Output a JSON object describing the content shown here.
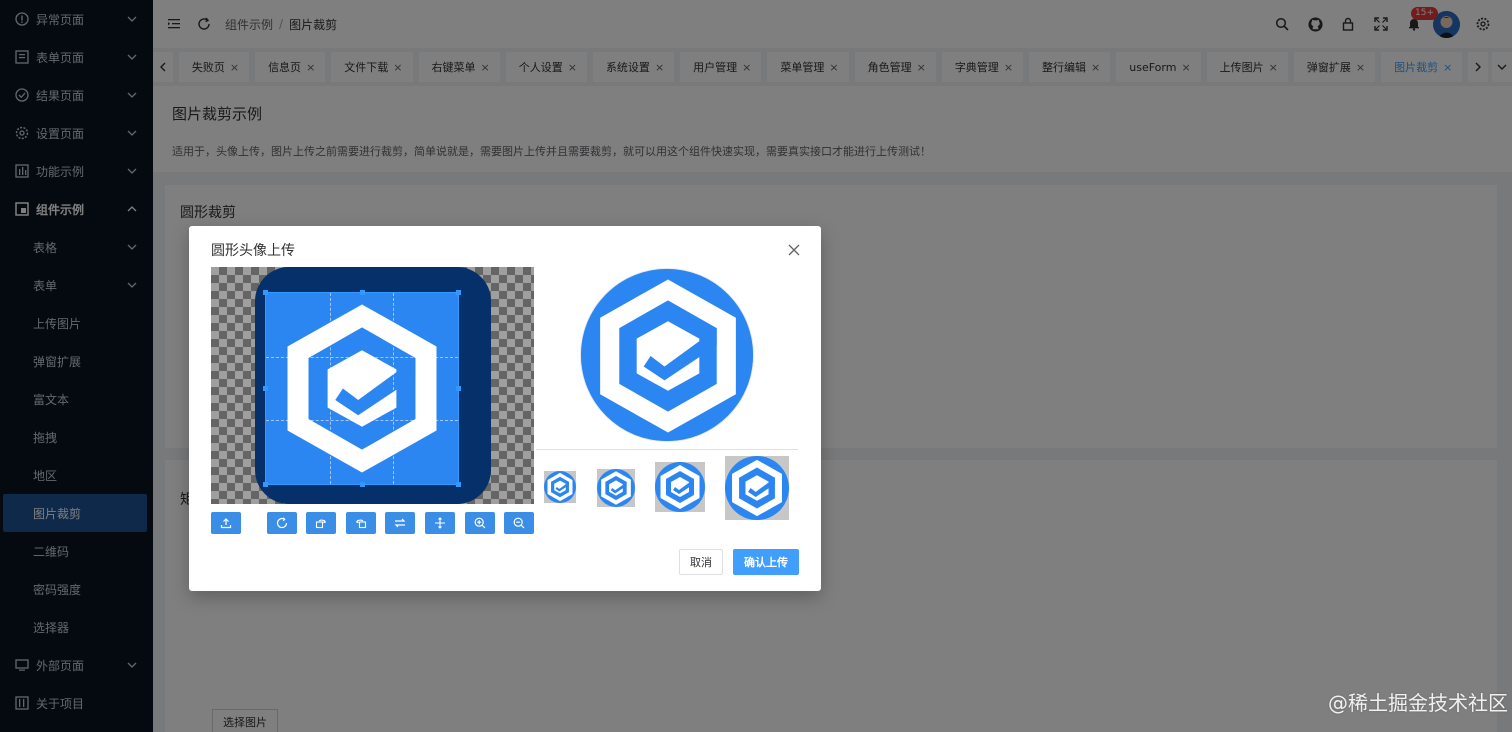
{
  "sidebar": {
    "items": [
      {
        "label": "异常页面",
        "icon": "info-circle-icon"
      },
      {
        "label": "表单页面",
        "icon": "form-icon"
      },
      {
        "label": "结果页面",
        "icon": "check-circle-icon"
      },
      {
        "label": "设置页面",
        "icon": "gear-icon"
      },
      {
        "label": "功能示例",
        "icon": "function-icon"
      },
      {
        "label": "组件示例",
        "icon": "component-icon"
      }
    ],
    "sub_items": [
      "表格",
      "表单",
      "上传图片",
      "弹窗扩展",
      "富文本",
      "拖拽",
      "地区",
      "图片裁剪",
      "二维码",
      "密码强度",
      "选择器"
    ],
    "bottom_items": [
      {
        "label": "外部页面",
        "icon": "monitor-icon"
      },
      {
        "label": "关于项目",
        "icon": "project-icon"
      }
    ]
  },
  "header": {
    "breadcrumb": [
      "组件示例",
      "图片裁剪"
    ],
    "breadcrumb_sep": "/",
    "notification_count": "15+"
  },
  "tabs": [
    "失败页",
    "信息页",
    "文件下载",
    "右键菜单",
    "个人设置",
    "系统设置",
    "用户管理",
    "菜单管理",
    "角色管理",
    "字典管理",
    "整行编辑",
    "useForm",
    "上传图片",
    "弹窗扩展",
    "图片裁剪"
  ],
  "tab_close": "×",
  "page": {
    "title": "图片裁剪示例",
    "description": "适用于，头像上传，图片上传之前需要进行裁剪，简单说就是，需要图片上传并且需要裁剪，就可以用这个组件快速实现，需要真实接口才能进行上传测试！",
    "card1_title": "圆形裁剪",
    "card2_title_partial": "矩",
    "select_image": "选择图片"
  },
  "modal": {
    "title": "圆形头像上传",
    "cancel": "取消",
    "confirm": "确认上传",
    "tools": [
      "upload-icon",
      "rotate-icon",
      "rotate-right-icon",
      "rotate-left-icon",
      "flip-horizontal-icon",
      "flip-vertical-icon",
      "zoom-in-icon",
      "zoom-out-icon"
    ]
  },
  "watermark": "@稀土掘金技术社区",
  "colors": {
    "sidebar_bg": "#0b1423",
    "active_menu": "#1e5296",
    "primary": "#409eff",
    "logo_blue": "#2c86f1"
  }
}
